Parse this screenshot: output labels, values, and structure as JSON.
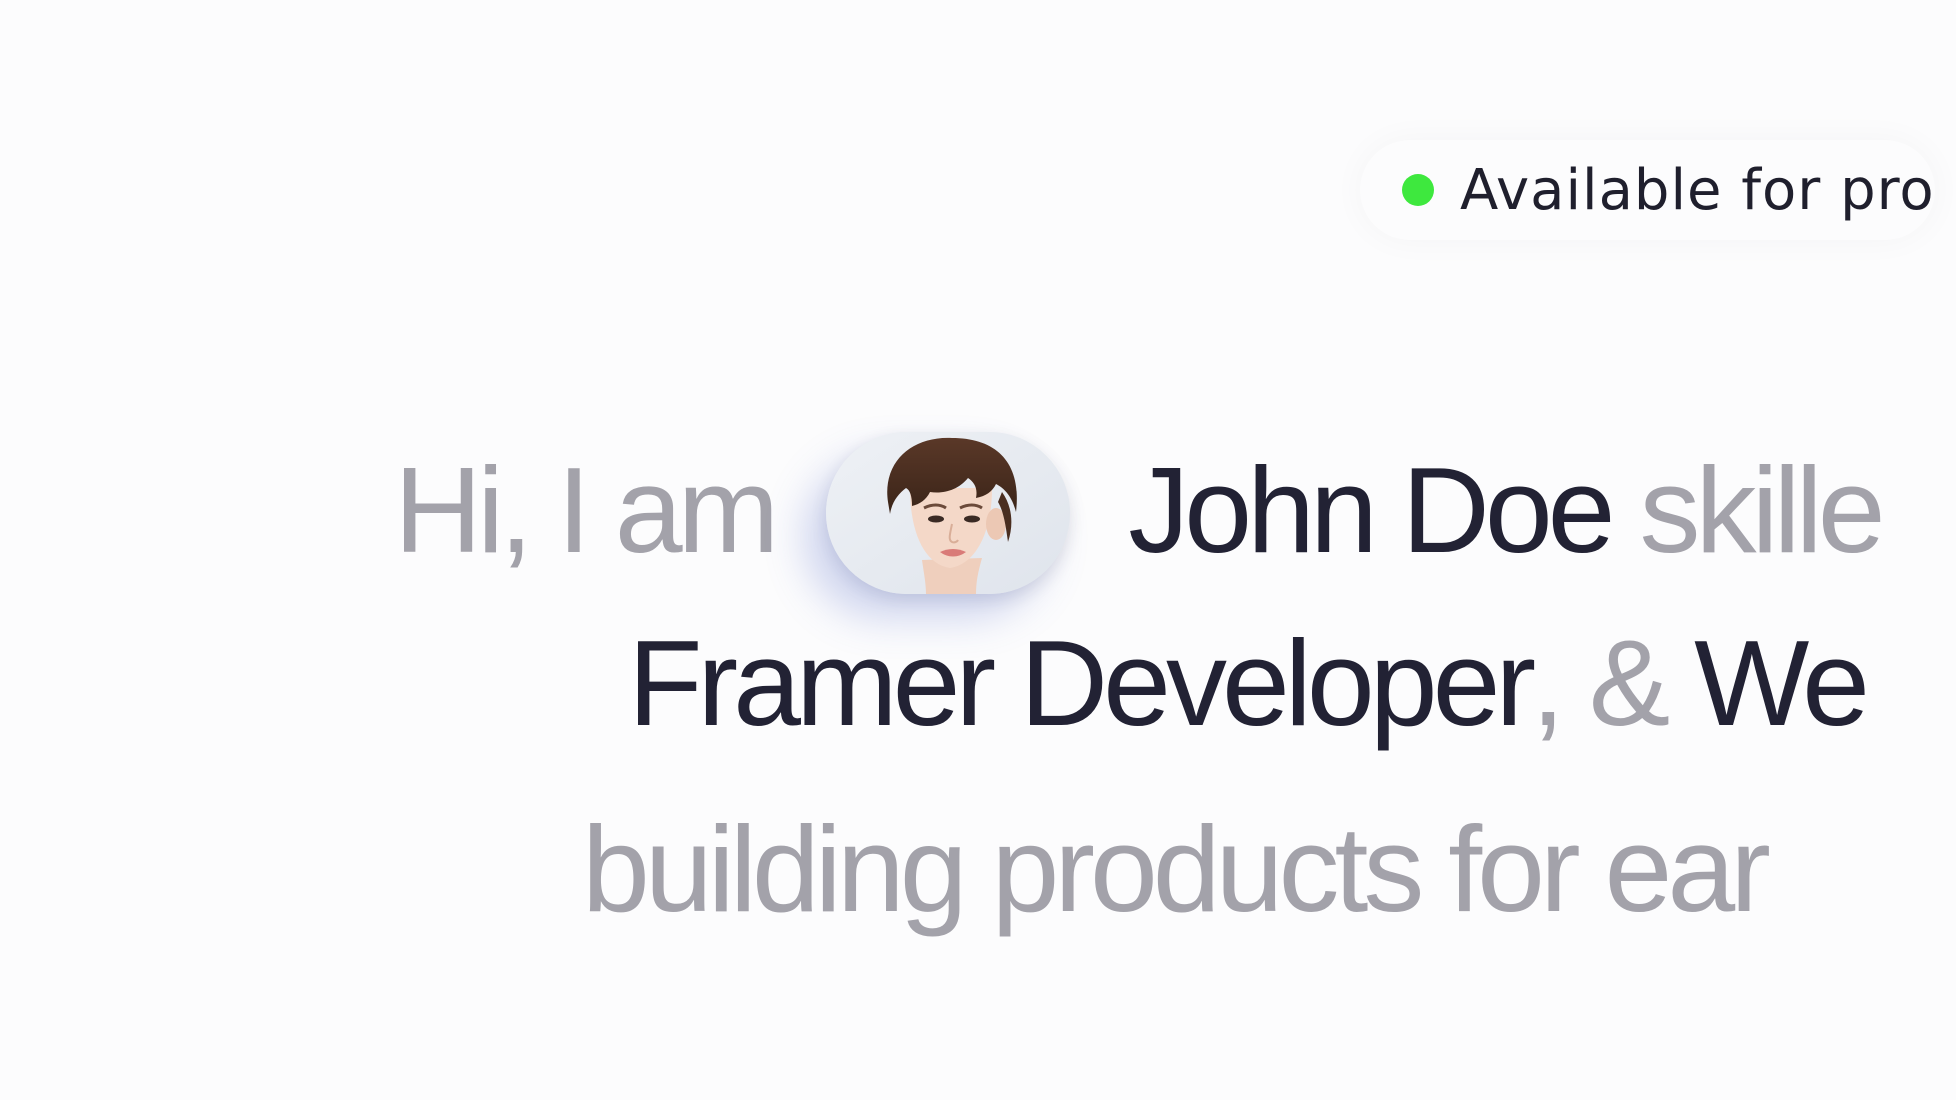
{
  "status": {
    "text": "Available for pro",
    "dot_color": "#3ee83e"
  },
  "hero": {
    "line1": {
      "intro": "Hi, I am",
      "name": "John Doe",
      "trail": "skille"
    },
    "line2": {
      "role": "Framer Developer",
      "sep": ", &",
      "next": "We"
    },
    "line3": {
      "text": "building products for ear"
    },
    "avatar_icon": "portrait-photo"
  },
  "colors": {
    "muted": "#a3a2aa",
    "strong": "#222234",
    "background": "#fcfcfd"
  }
}
